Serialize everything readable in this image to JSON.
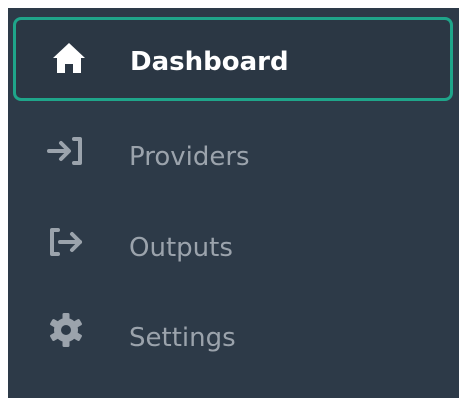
{
  "sidebar": {
    "items": [
      {
        "label": "Dashboard",
        "icon": "home-icon",
        "active": true
      },
      {
        "label": "Providers",
        "icon": "sign-in-icon",
        "active": false
      },
      {
        "label": "Outputs",
        "icon": "sign-out-icon",
        "active": false
      },
      {
        "label": "Settings",
        "icon": "gear-icon",
        "active": false
      }
    ]
  },
  "colors": {
    "background": "#2d3a48",
    "active_border": "#1fa58a",
    "active_text": "#ffffff",
    "inactive_text": "#9ba3ac"
  }
}
